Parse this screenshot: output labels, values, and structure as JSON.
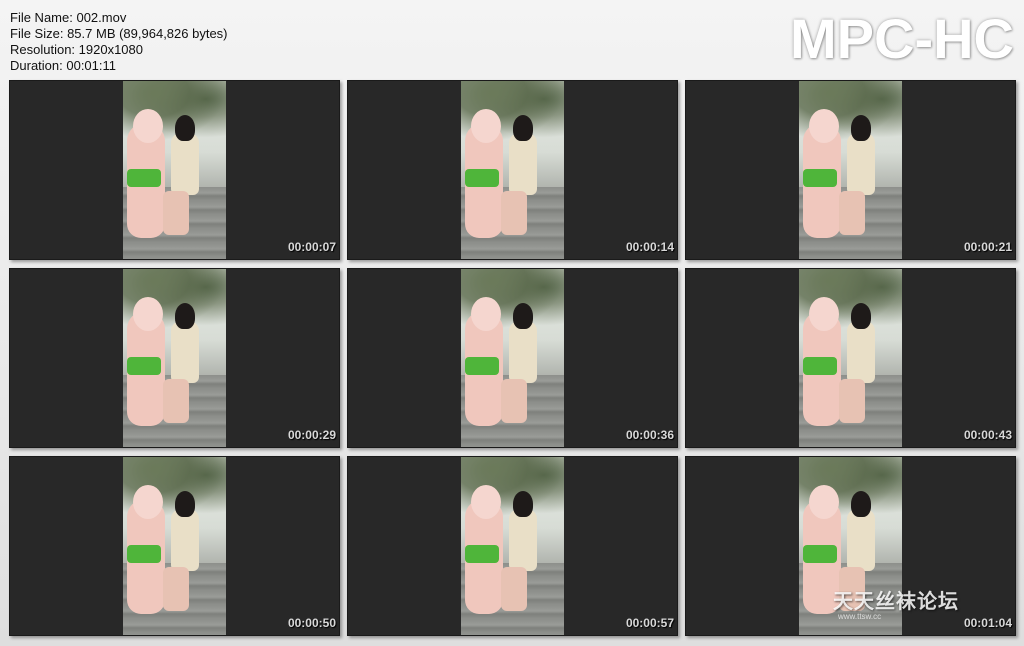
{
  "info": {
    "file_name": "File Name: 002.mov",
    "file_size": "File Size: 85.7 MB (89,964,826 bytes)",
    "resolution": "Resolution: 1920x1080",
    "duration": "Duration: 00:01:11"
  },
  "brand": {
    "label": "MPC-HC"
  },
  "thumbnails": [
    {
      "timestamp": "00:00:07"
    },
    {
      "timestamp": "00:00:14"
    },
    {
      "timestamp": "00:00:21"
    },
    {
      "timestamp": "00:00:29"
    },
    {
      "timestamp": "00:00:36"
    },
    {
      "timestamp": "00:00:43"
    },
    {
      "timestamp": "00:00:50"
    },
    {
      "timestamp": "00:00:57"
    },
    {
      "timestamp": "00:01:04"
    }
  ],
  "watermark": {
    "text": "天天丝袜论坛",
    "sub": "www.ttsw.cc"
  }
}
